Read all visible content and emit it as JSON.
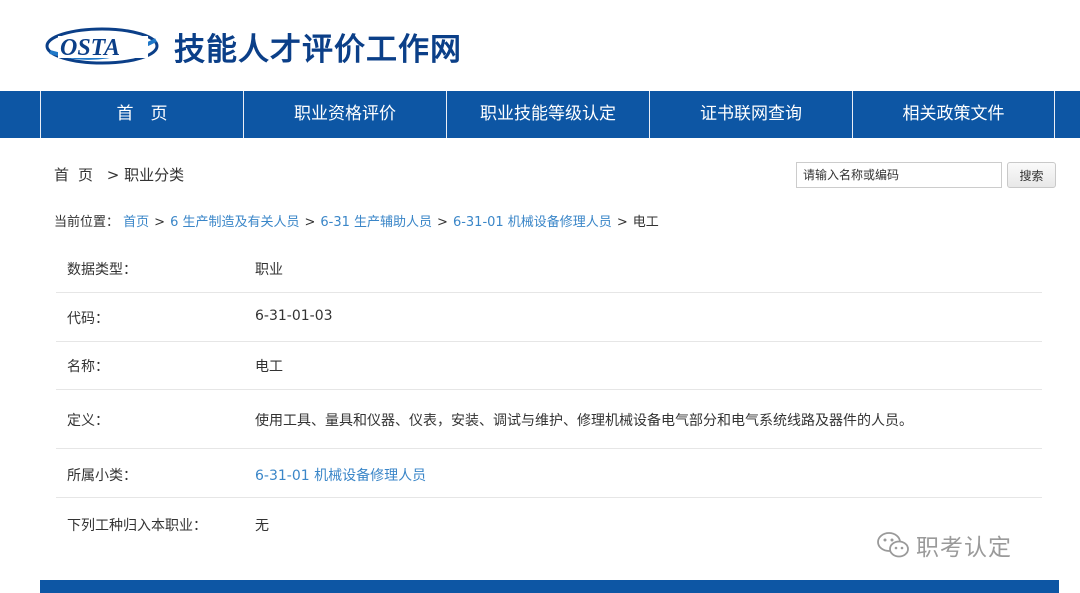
{
  "header": {
    "logo_text": "OSTA",
    "site_title": "技能人才评价工作网"
  },
  "nav": {
    "items": [
      {
        "label": "首　页"
      },
      {
        "label": "职业资格评价"
      },
      {
        "label": "职业技能等级认定"
      },
      {
        "label": "证书联网查询"
      },
      {
        "label": "相关政策文件"
      }
    ]
  },
  "breadcrumb_top": {
    "home": "首页",
    "separator": " > ",
    "current": "职业分类"
  },
  "search": {
    "placeholder": "请输入名称或编码",
    "button_label": "搜索"
  },
  "location": {
    "prefix": "当前位置：",
    "links": [
      "首页",
      "6 生产制造及有关人员",
      "6-31 生产辅助人员",
      "6-31-01 机械设备修理人员"
    ],
    "separator": ">",
    "current": "电工"
  },
  "detail": [
    {
      "key": "数据类型：",
      "value": "职业"
    },
    {
      "key": "代码：",
      "value": "6-31-01-03"
    },
    {
      "key": "名称：",
      "value": "电工"
    },
    {
      "key": "定义：",
      "value": "使用工具、量具和仪器、仪表，安装、调试与维护、修理机械设备电气部分和电气系统线路及器件的人员。"
    },
    {
      "key": "所属小类：",
      "value": "6-31-01 机械设备修理人员"
    },
    {
      "key": "下列工种归入本职业：",
      "value": "无"
    }
  ],
  "watermark": {
    "text": "职考认定",
    "icon": "wechat-icon"
  },
  "colors": {
    "nav_bg": "#0d56a4",
    "title": "#0b3f88",
    "link": "#3a86c8"
  }
}
